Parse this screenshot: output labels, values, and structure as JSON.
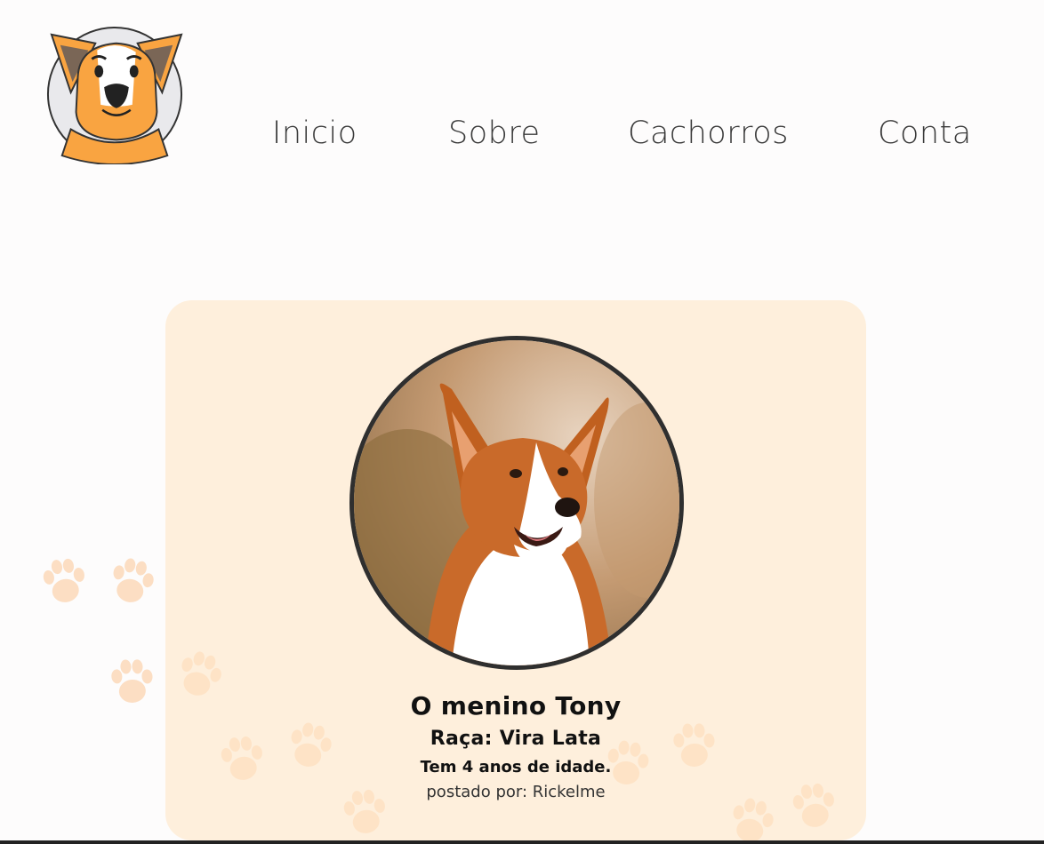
{
  "nav": {
    "items": [
      "Inicio",
      "Sobre",
      "Cachorros",
      "Conta"
    ]
  },
  "card": {
    "name": "O menino Tony",
    "breed": "Raça: Vira Lata",
    "age": "Tem 4 anos de idade.",
    "poster": "postado por: Rickelme"
  },
  "colors": {
    "brand_orange": "#f9a441",
    "card_bg": "#ffe6c8",
    "text_dark": "#3a3a3a",
    "paw": "#fbd1ab"
  },
  "icons": {
    "logo": "dog-logo-icon",
    "paws": "paw-print-icon"
  }
}
